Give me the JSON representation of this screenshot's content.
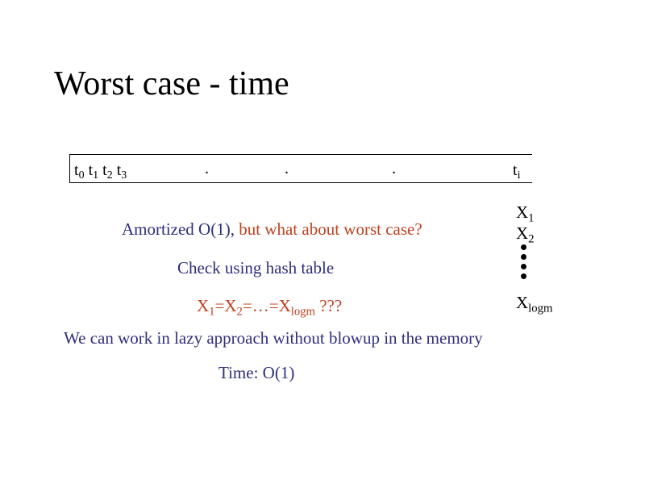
{
  "slide": {
    "title": "Worst case - time",
    "timeline": {
      "labels": [
        {
          "base": "t",
          "sub": "0"
        },
        {
          "base": "t",
          "sub": "1"
        },
        {
          "base": "t",
          "sub": "2"
        },
        {
          "base": "t",
          "sub": "3"
        }
      ],
      "dots": [
        ".",
        ".",
        "."
      ],
      "last_label": {
        "base": "t",
        "sub": "i"
      }
    },
    "amortized_line": {
      "part1": "Amortized O(1),",
      "part2": " but what about worst case?"
    },
    "x_list": {
      "first": {
        "base": "X",
        "sub": "1"
      },
      "second": {
        "base": "X",
        "sub": "2"
      },
      "last": {
        "base": "X",
        "sub": "logm"
      }
    },
    "check_line": "Check using hash table",
    "equality": {
      "x1": {
        "base": "X",
        "sub": "1"
      },
      "eq1": "=",
      "x2": {
        "base": "X",
        "sub": "2"
      },
      "eq2": "=…=",
      "xlogm": {
        "base": "X",
        "sub": "logm"
      },
      "suffix": " ???"
    },
    "lazy_line": "We can work in lazy approach without blowup in the memory",
    "time_line": "Time: O(1)",
    "colors": {
      "blue_text": "#2e2e7e",
      "red_text": "#c0401e",
      "black": "#000000"
    }
  }
}
